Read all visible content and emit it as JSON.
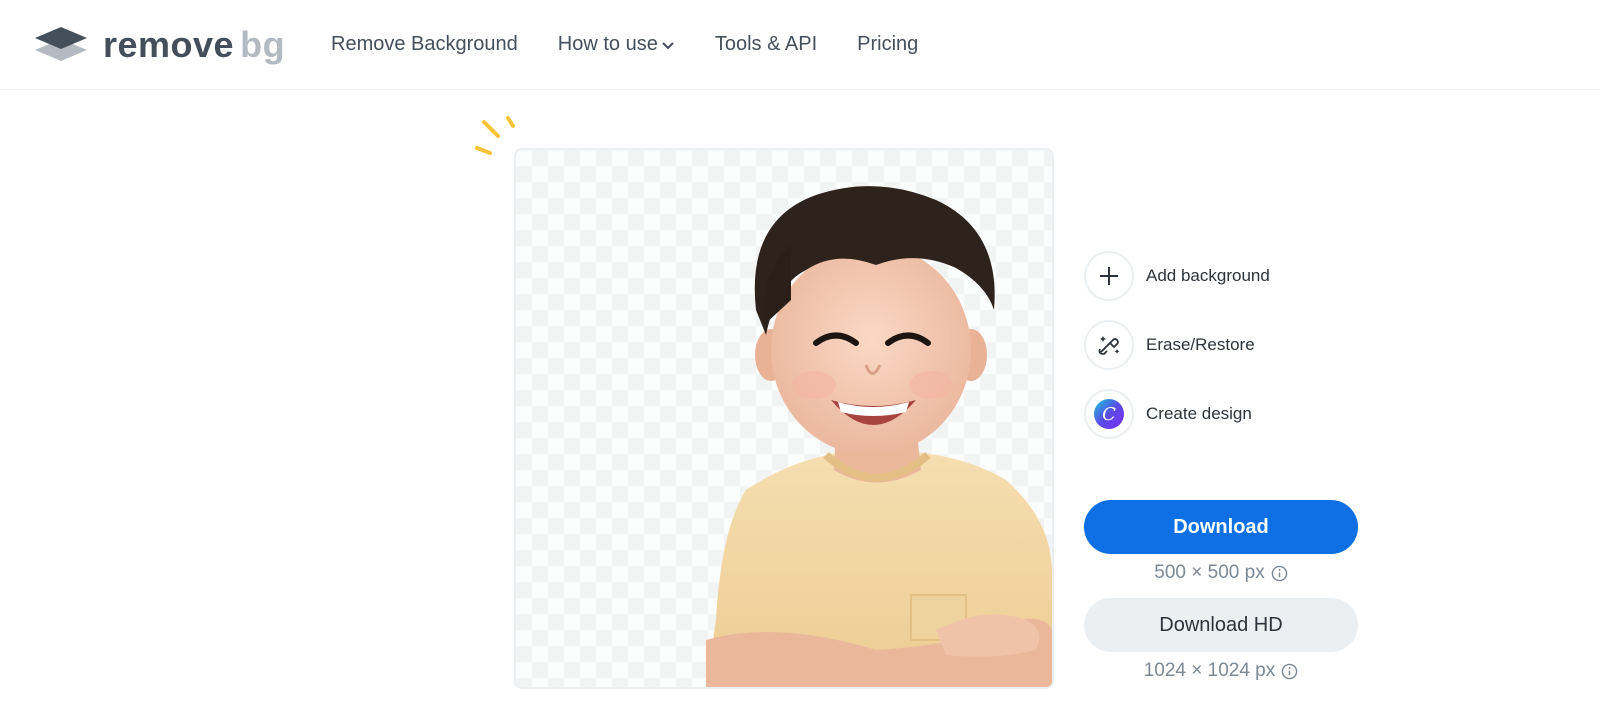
{
  "brand": {
    "word1": "remove",
    "word2": "bg"
  },
  "nav": [
    {
      "label": "Remove Background"
    },
    {
      "label": "How to use"
    },
    {
      "label": "Tools & API"
    },
    {
      "label": "Pricing"
    }
  ],
  "actions": {
    "add_background": "Add background",
    "erase_restore": "Erase/Restore",
    "create_design": "Create design"
  },
  "download": {
    "label": "Download",
    "size": "500 × 500 px"
  },
  "download_hd": {
    "label": "Download HD",
    "size": "1024 × 1024 px"
  },
  "colors": {
    "primary": "#0f70e6",
    "text": "#454f5b",
    "accent_sparkle": "#f7c235"
  },
  "icons": {
    "logo": "layers-icon",
    "nav_dropdown": "chevron-down-icon",
    "add": "plus-icon",
    "erase": "magic-brush-icon",
    "design": "canva-icon",
    "info": "info-icon"
  }
}
